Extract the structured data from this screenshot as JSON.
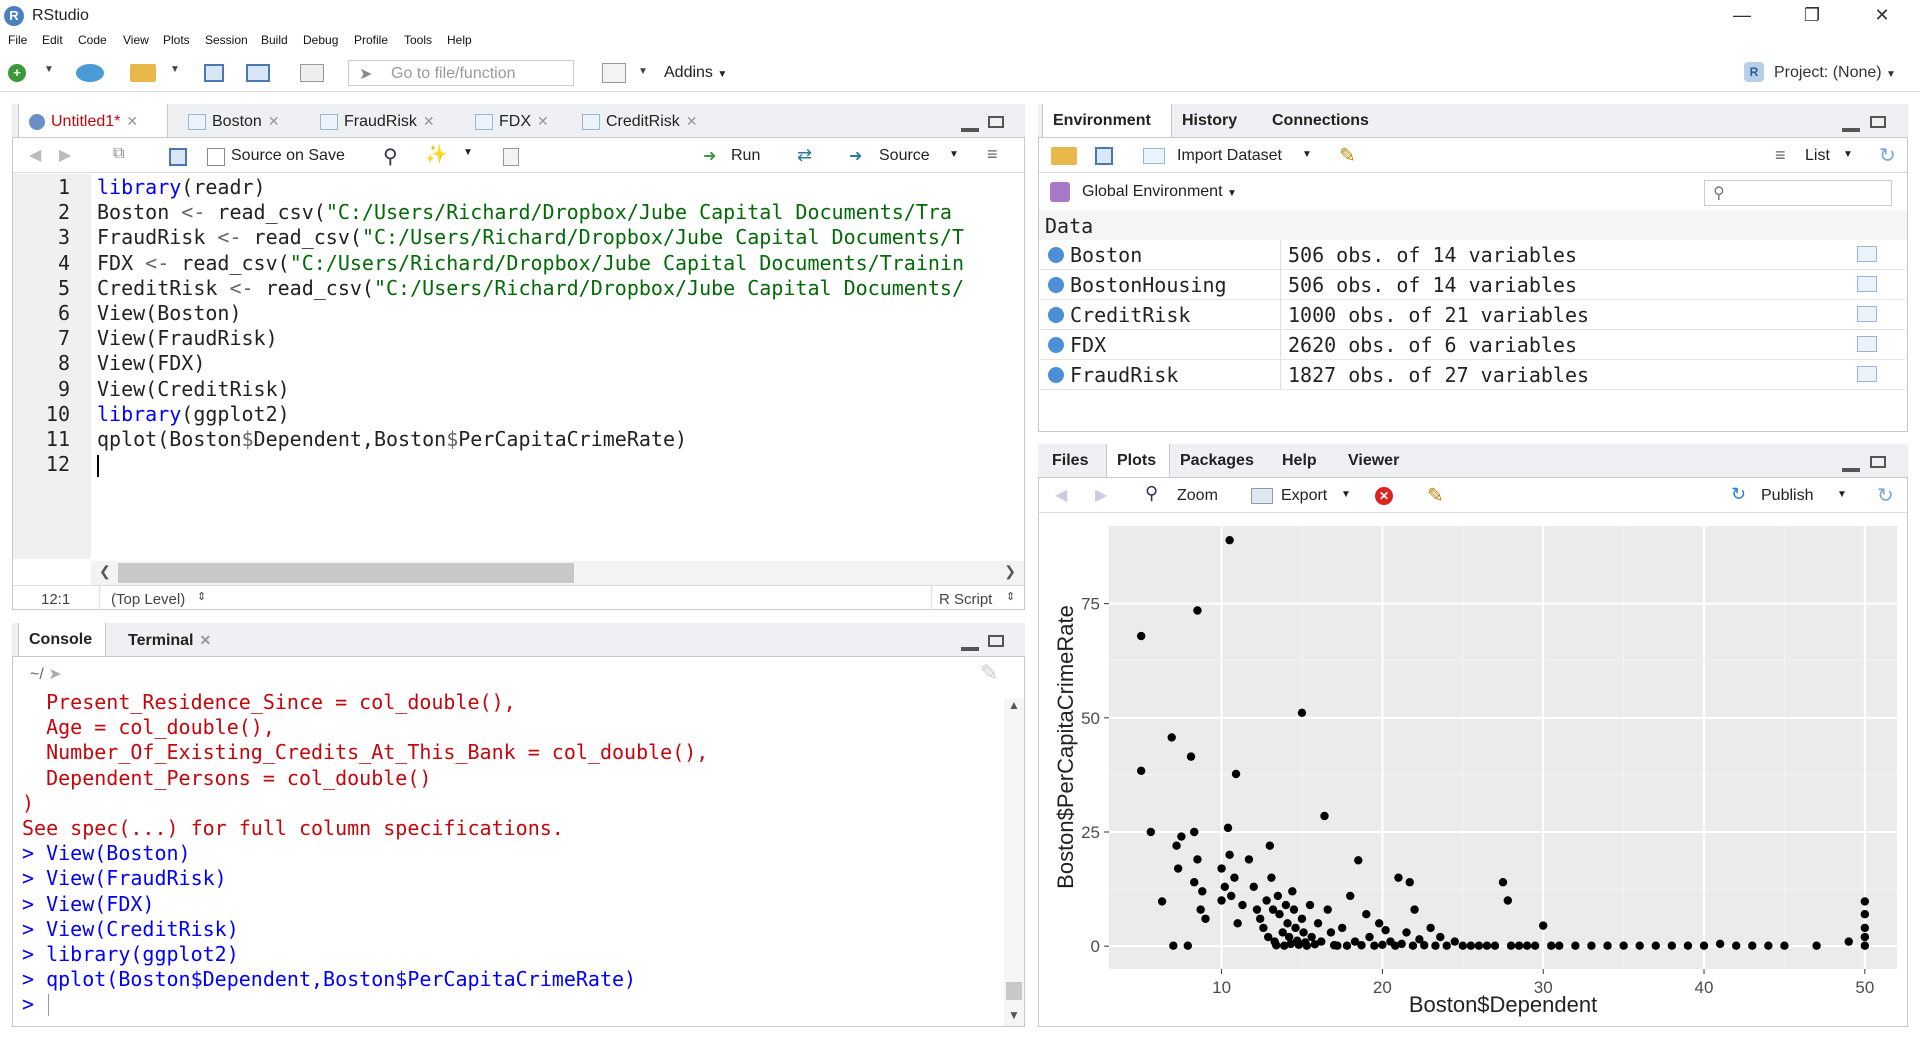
{
  "window": {
    "title": "RStudio",
    "app_icon": "R"
  },
  "menu": [
    "File",
    "Edit",
    "Code",
    "View",
    "Plots",
    "Session",
    "Build",
    "Debug",
    "Profile",
    "Tools",
    "Help"
  ],
  "toolbar": {
    "goto_placeholder": "Go to file/function",
    "addins_label": "Addins",
    "project_label": "Project: (None)"
  },
  "editor": {
    "tabs": [
      {
        "label": "Untitled1*",
        "active": true
      },
      {
        "label": "Boston"
      },
      {
        "label": "FraudRisk"
      },
      {
        "label": "FDX"
      },
      {
        "label": "CreditRisk"
      }
    ],
    "source_on_save": "Source on Save",
    "run_label": "Run",
    "source_label": "Source",
    "lines": [
      {
        "num": "1",
        "parts": [
          {
            "t": "library",
            "c": "kw"
          },
          {
            "t": "(readr)",
            "c": ""
          }
        ]
      },
      {
        "num": "2",
        "parts": [
          {
            "t": "Boston ",
            "c": ""
          },
          {
            "t": "<-",
            "c": "op"
          },
          {
            "t": " read_csv(",
            "c": ""
          },
          {
            "t": "\"C:/Users/Richard/Dropbox/Jube Capital Documents/Tra",
            "c": "str"
          }
        ]
      },
      {
        "num": "3",
        "parts": [
          {
            "t": "FraudRisk ",
            "c": ""
          },
          {
            "t": "<-",
            "c": "op"
          },
          {
            "t": " read_csv(",
            "c": ""
          },
          {
            "t": "\"C:/Users/Richard/Dropbox/Jube Capital Documents/T",
            "c": "str"
          }
        ]
      },
      {
        "num": "4",
        "parts": [
          {
            "t": "FDX ",
            "c": ""
          },
          {
            "t": "<-",
            "c": "op"
          },
          {
            "t": " read_csv(",
            "c": ""
          },
          {
            "t": "\"C:/Users/Richard/Dropbox/Jube Capital Documents/Trainin",
            "c": "str"
          }
        ]
      },
      {
        "num": "5",
        "parts": [
          {
            "t": "CreditRisk ",
            "c": ""
          },
          {
            "t": "<-",
            "c": "op"
          },
          {
            "t": " read_csv(",
            "c": ""
          },
          {
            "t": "\"C:/Users/Richard/Dropbox/Jube Capital Documents/",
            "c": "str"
          }
        ]
      },
      {
        "num": "6",
        "parts": [
          {
            "t": "View(Boston)",
            "c": ""
          }
        ]
      },
      {
        "num": "7",
        "parts": [
          {
            "t": "View(FraudRisk)",
            "c": ""
          }
        ]
      },
      {
        "num": "8",
        "parts": [
          {
            "t": "View(FDX)",
            "c": ""
          }
        ]
      },
      {
        "num": "9",
        "parts": [
          {
            "t": "View(CreditRisk)",
            "c": ""
          }
        ]
      },
      {
        "num": "10",
        "parts": [
          {
            "t": "library",
            "c": "kw"
          },
          {
            "t": "(ggplot2)",
            "c": ""
          }
        ]
      },
      {
        "num": "11",
        "parts": [
          {
            "t": "qplot(Boston",
            "c": ""
          },
          {
            "t": "$",
            "c": "op"
          },
          {
            "t": "Dependent,Boston",
            "c": ""
          },
          {
            "t": "$",
            "c": "op"
          },
          {
            "t": "PerCapitaCrimeRate)",
            "c": ""
          }
        ]
      },
      {
        "num": "12",
        "parts": []
      }
    ],
    "status_position": "12:1",
    "status_scope": "(Top Level)",
    "status_type": "R Script"
  },
  "console": {
    "tabs": [
      "Console",
      "Terminal"
    ],
    "path": "~/",
    "lines": [
      {
        "t": "  Present_Residence_Since = col_double(),",
        "c": "red"
      },
      {
        "t": "  Age = col_double(),",
        "c": "red"
      },
      {
        "t": "  Number_Of_Existing_Credits_At_This_Bank = col_double(),",
        "c": "red"
      },
      {
        "t": "  Dependent_Persons = col_double()",
        "c": "red"
      },
      {
        "t": ")",
        "c": "red"
      },
      {
        "t": "See spec(...) for full column specifications.",
        "c": "red"
      },
      {
        "t": "> View(Boston)",
        "c": "blue"
      },
      {
        "t": "> View(FraudRisk)",
        "c": "blue"
      },
      {
        "t": "> View(FDX)",
        "c": "blue"
      },
      {
        "t": "> View(CreditRisk)",
        "c": "blue"
      },
      {
        "t": "> library(ggplot2)",
        "c": "blue"
      },
      {
        "t": "> qplot(Boston$Dependent,Boston$PerCapitaCrimeRate)",
        "c": "blue"
      },
      {
        "t": "> ",
        "c": "blue"
      }
    ]
  },
  "environment": {
    "tabs": [
      "Environment",
      "History",
      "Connections"
    ],
    "import_label": "Import Dataset",
    "list_label": "List",
    "scope_label": "Global Environment",
    "section": "Data",
    "rows": [
      {
        "name": "Boston",
        "value": "506 obs. of 14 variables"
      },
      {
        "name": "BostonHousing",
        "value": "506 obs. of 14 variables"
      },
      {
        "name": "CreditRisk",
        "value": "1000 obs. of 21 variables"
      },
      {
        "name": "FDX",
        "value": "2620 obs. of 6 variables"
      },
      {
        "name": "FraudRisk",
        "value": "1827 obs. of 27 variables"
      }
    ]
  },
  "files_pane": {
    "tabs": [
      "Files",
      "Plots",
      "Packages",
      "Help",
      "Viewer"
    ],
    "zoom_label": "Zoom",
    "export_label": "Export",
    "publish_label": "Publish"
  },
  "chart_data": {
    "type": "scatter",
    "xlabel": "Boston$Dependent",
    "ylabel": "Boston$PerCapitaCrimeRate",
    "xlim": [
      3,
      52
    ],
    "ylim": [
      -5,
      92
    ],
    "xticks": [
      10,
      20,
      30,
      40,
      50
    ],
    "yticks": [
      0,
      25,
      50,
      75
    ],
    "grid": true,
    "points": [
      [
        5,
        67.9
      ],
      [
        5,
        38.4
      ],
      [
        5.6,
        25
      ],
      [
        6.3,
        9.8
      ],
      [
        6.9,
        45.7
      ],
      [
        7,
        0.1
      ],
      [
        7.2,
        22
      ],
      [
        7.3,
        17
      ],
      [
        7.5,
        24
      ],
      [
        7.9,
        0.1
      ],
      [
        8.1,
        41.5
      ],
      [
        8.3,
        25
      ],
      [
        8.5,
        73.5
      ],
      [
        8.3,
        14
      ],
      [
        8.5,
        19
      ],
      [
        8.8,
        12
      ],
      [
        8.7,
        8
      ],
      [
        9,
        6
      ],
      [
        10,
        17
      ],
      [
        10,
        10
      ],
      [
        10.2,
        13
      ],
      [
        10.5,
        88.9
      ],
      [
        10.4,
        25.9
      ],
      [
        10.5,
        20
      ],
      [
        10.6,
        11
      ],
      [
        10.8,
        15
      ],
      [
        10.9,
        37.7
      ],
      [
        11,
        5
      ],
      [
        11.3,
        9
      ],
      [
        11.7,
        19
      ],
      [
        12,
        13
      ],
      [
        12.2,
        8
      ],
      [
        12.4,
        6
      ],
      [
        12.6,
        4
      ],
      [
        12.8,
        10
      ],
      [
        12.9,
        2
      ],
      [
        13,
        22
      ],
      [
        13.1,
        15
      ],
      [
        13.2,
        8
      ],
      [
        13.3,
        1
      ],
      [
        13.4,
        0.2
      ],
      [
        13.5,
        11
      ],
      [
        13.6,
        7
      ],
      [
        13.8,
        3
      ],
      [
        13.9,
        0.1
      ],
      [
        14,
        9
      ],
      [
        14.1,
        5
      ],
      [
        14.2,
        2
      ],
      [
        14.3,
        0.5
      ],
      [
        14.4,
        12
      ],
      [
        14.5,
        8
      ],
      [
        14.6,
        4
      ],
      [
        14.7,
        1.2
      ],
      [
        14.8,
        0.3
      ],
      [
        15,
        51.1
      ],
      [
        15,
        6
      ],
      [
        15.1,
        3
      ],
      [
        15.2,
        0.8
      ],
      [
        15.3,
        0.1
      ],
      [
        15.5,
        9
      ],
      [
        15.6,
        2
      ],
      [
        15.8,
        0.4
      ],
      [
        16,
        5
      ],
      [
        16.2,
        1
      ],
      [
        16.4,
        28.5
      ],
      [
        16.6,
        8
      ],
      [
        16.8,
        3
      ],
      [
        17,
        0.2
      ],
      [
        17.2,
        0.1
      ],
      [
        17.5,
        4
      ],
      [
        17.8,
        0.1
      ],
      [
        18,
        11
      ],
      [
        18.3,
        1
      ],
      [
        18.5,
        18.8
      ],
      [
        18.7,
        0.2
      ],
      [
        19,
        7
      ],
      [
        19.2,
        2
      ],
      [
        19.5,
        0.1
      ],
      [
        19.8,
        5
      ],
      [
        20,
        0.3
      ],
      [
        20.2,
        3.5
      ],
      [
        20.5,
        1
      ],
      [
        20.8,
        0.1
      ],
      [
        21,
        15
      ],
      [
        21.2,
        0.5
      ],
      [
        21.5,
        3
      ],
      [
        21.7,
        14
      ],
      [
        21.9,
        0.1
      ],
      [
        22,
        8
      ],
      [
        22.3,
        1.5
      ],
      [
        22.6,
        0.2
      ],
      [
        23,
        4
      ],
      [
        23.3,
        0.1
      ],
      [
        23.6,
        2
      ],
      [
        24,
        0.1
      ],
      [
        24.5,
        1
      ],
      [
        25,
        0.1
      ],
      [
        25.5,
        0.1
      ],
      [
        26,
        0.1
      ],
      [
        26.5,
        0.1
      ],
      [
        27,
        0.1
      ],
      [
        27.5,
        14
      ],
      [
        27.8,
        10
      ],
      [
        28,
        0.1
      ],
      [
        28.5,
        0.1
      ],
      [
        29,
        0.1
      ],
      [
        29.5,
        0.1
      ],
      [
        30,
        4.5
      ],
      [
        30.5,
        0.1
      ],
      [
        31,
        0.1
      ],
      [
        32,
        0.1
      ],
      [
        33,
        0.1
      ],
      [
        34,
        0.1
      ],
      [
        35,
        0.1
      ],
      [
        36,
        0.1
      ],
      [
        37,
        0.1
      ],
      [
        38,
        0.1
      ],
      [
        39,
        0.1
      ],
      [
        40,
        0.1
      ],
      [
        41,
        0.5
      ],
      [
        42,
        0.1
      ],
      [
        43,
        0.1
      ],
      [
        44,
        0.1
      ],
      [
        45,
        0.1
      ],
      [
        47,
        0.1
      ],
      [
        49,
        1
      ],
      [
        50,
        0.1
      ],
      [
        50,
        4
      ],
      [
        50,
        7
      ],
      [
        50,
        9.8
      ],
      [
        50,
        2
      ]
    ]
  }
}
